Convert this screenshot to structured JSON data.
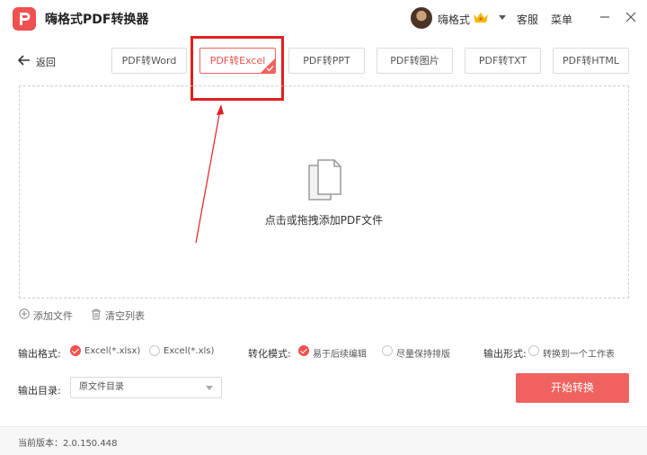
{
  "app": {
    "title": "嗨格式PDF转换器"
  },
  "user": {
    "name": "嗨格式"
  },
  "header": {
    "service": "客服",
    "menu": "菜单"
  },
  "nav": {
    "back": "返回"
  },
  "tabs": [
    {
      "label": "PDF转Word"
    },
    {
      "label": "PDF转Excel",
      "active": true
    },
    {
      "label": "PDF转PPT"
    },
    {
      "label": "PDF转图片"
    },
    {
      "label": "PDF转TXT"
    },
    {
      "label": "PDF转HTML"
    }
  ],
  "drop": {
    "hint": "点击或拖拽添加PDF文件"
  },
  "actions": {
    "add_file": "添加文件",
    "clear_list": "清空列表"
  },
  "options": {
    "format": {
      "label": "输出格式:",
      "choices": [
        "Excel(*.xlsx)",
        "Excel(*.xls)"
      ],
      "selected": "Excel(*.xlsx)"
    },
    "mode": {
      "label": "转化模式:",
      "choices": [
        "易于后续编辑",
        "尽量保持排版"
      ],
      "selected": "易于后续编辑"
    },
    "output_form": {
      "label": "输出形式:",
      "choices": [
        "转换到一个工作表"
      ]
    }
  },
  "output_dir": {
    "label": "输出目录:",
    "value": "原文件目录"
  },
  "start": {
    "label": "开始转换"
  },
  "footer": {
    "version": "当前版本：2.0.150.448"
  },
  "colors": {
    "accent": "#f0504f",
    "highlight": "#e02020"
  }
}
